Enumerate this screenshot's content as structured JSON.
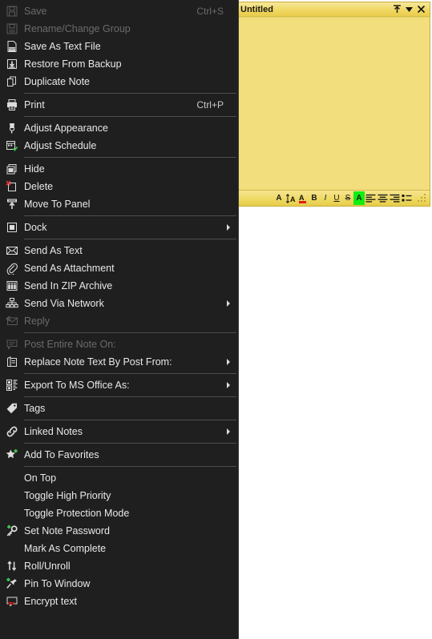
{
  "note": {
    "title": "Untitled",
    "body_text": "",
    "titlebar_buttons": [
      {
        "name": "roll-up-button",
        "glyph": "↑"
      },
      {
        "name": "note-menu-button",
        "glyph": "▼"
      },
      {
        "name": "close-button",
        "glyph": "✕"
      }
    ],
    "toolbar": [
      {
        "name": "font-button",
        "label": "A"
      },
      {
        "name": "line-spacing-button",
        "label": "A"
      },
      {
        "name": "font-color-button",
        "label": "A"
      },
      {
        "name": "bold-button",
        "label": "B"
      },
      {
        "name": "italic-button",
        "label": "I"
      },
      {
        "name": "underline-button",
        "label": "U"
      },
      {
        "name": "strikethrough-button",
        "label": "S"
      },
      {
        "name": "highlight-button",
        "label": "A"
      },
      {
        "name": "align-left-button",
        "label": ""
      },
      {
        "name": "align-center-button",
        "label": ""
      },
      {
        "name": "align-right-button",
        "label": ""
      },
      {
        "name": "bullet-list-button",
        "label": ""
      }
    ],
    "colors": {
      "note_bg": "#f3de7e",
      "titlebar": "#f0d864",
      "border": "#c9ad3a",
      "highlight": "#11ee11",
      "font_color_swatch": "#e01b1b"
    }
  },
  "menu": {
    "items": [
      {
        "id": "save",
        "label": "Save",
        "accel": "Ctrl+S",
        "icon": "save-icon",
        "disabled": true,
        "submenu": false
      },
      {
        "id": "rename",
        "label": "Rename/Change Group",
        "accel": "",
        "icon": "rename-icon",
        "disabled": true,
        "submenu": false
      },
      {
        "id": "save-as-text",
        "label": "Save As Text File",
        "accel": "",
        "icon": "save-text-file-icon",
        "disabled": false,
        "submenu": false
      },
      {
        "id": "restore-backup",
        "label": "Restore From Backup",
        "accel": "",
        "icon": "restore-backup-icon",
        "disabled": false,
        "submenu": false
      },
      {
        "id": "duplicate-note",
        "label": "Duplicate Note",
        "accel": "",
        "icon": "duplicate-icon",
        "disabled": false,
        "submenu": false
      },
      {
        "id": "sep1",
        "separator": true
      },
      {
        "id": "print",
        "label": "Print",
        "accel": "Ctrl+P",
        "icon": "printer-icon",
        "disabled": false,
        "submenu": false
      },
      {
        "id": "sep2",
        "separator": true
      },
      {
        "id": "adjust-appearance",
        "label": "Adjust Appearance",
        "accel": "",
        "icon": "paintbrush-icon",
        "disabled": false,
        "submenu": false
      },
      {
        "id": "adjust-schedule",
        "label": "Adjust Schedule",
        "accel": "",
        "icon": "calendar-icon",
        "disabled": false,
        "submenu": false
      },
      {
        "id": "sep3",
        "separator": true
      },
      {
        "id": "hide",
        "label": "Hide",
        "accel": "",
        "icon": "hide-windows-icon",
        "disabled": false,
        "submenu": false
      },
      {
        "id": "delete",
        "label": "Delete",
        "accel": "",
        "icon": "delete-icon",
        "disabled": false,
        "submenu": false
      },
      {
        "id": "move-to-panel",
        "label": "Move To Panel",
        "accel": "",
        "icon": "move-to-panel-icon",
        "disabled": false,
        "submenu": false
      },
      {
        "id": "sep4",
        "separator": true
      },
      {
        "id": "dock",
        "label": "Dock",
        "accel": "",
        "icon": "dock-icon",
        "disabled": false,
        "submenu": true
      },
      {
        "id": "sep5",
        "separator": true
      },
      {
        "id": "send-as-text",
        "label": "Send As Text",
        "accel": "",
        "icon": "envelope-icon",
        "disabled": false,
        "submenu": false
      },
      {
        "id": "send-as-attach",
        "label": "Send As Attachment",
        "accel": "",
        "icon": "paperclip-icon",
        "disabled": false,
        "submenu": false
      },
      {
        "id": "send-zip",
        "label": "Send In ZIP Archive",
        "accel": "",
        "icon": "zip-archive-icon",
        "disabled": false,
        "submenu": false
      },
      {
        "id": "send-network",
        "label": "Send Via Network",
        "accel": "",
        "icon": "network-icon",
        "disabled": false,
        "submenu": true
      },
      {
        "id": "reply",
        "label": "Reply",
        "accel": "",
        "icon": "reply-icon",
        "disabled": true,
        "submenu": false
      },
      {
        "id": "sep6",
        "separator": true
      },
      {
        "id": "post-entire",
        "label": "Post Entire Note On:",
        "accel": "",
        "icon": "comment-icon",
        "disabled": true,
        "submenu": false
      },
      {
        "id": "replace-note",
        "label": "Replace Note Text By Post From:",
        "accel": "",
        "icon": "inbox-icon",
        "disabled": false,
        "submenu": true
      },
      {
        "id": "sep7",
        "separator": true
      },
      {
        "id": "export-office",
        "label": "Export To MS Office As:",
        "accel": "",
        "icon": "ms-office-icon",
        "disabled": false,
        "submenu": true
      },
      {
        "id": "sep8",
        "separator": true
      },
      {
        "id": "tags",
        "label": "Tags",
        "accel": "",
        "icon": "tag-icon",
        "disabled": false,
        "submenu": false
      },
      {
        "id": "sep9",
        "separator": true
      },
      {
        "id": "linked-notes",
        "label": "Linked Notes",
        "accel": "",
        "icon": "link-icon",
        "disabled": false,
        "submenu": true
      },
      {
        "id": "sep10",
        "separator": true
      },
      {
        "id": "add-favorites",
        "label": "Add To Favorites",
        "accel": "",
        "icon": "star-plus-icon",
        "disabled": false,
        "submenu": false
      },
      {
        "id": "sep11",
        "separator": true
      },
      {
        "id": "on-top",
        "label": "On Top",
        "accel": "",
        "icon": "none",
        "disabled": false,
        "submenu": false
      },
      {
        "id": "toggle-priority",
        "label": "Toggle High Priority",
        "accel": "",
        "icon": "none",
        "disabled": false,
        "submenu": false
      },
      {
        "id": "toggle-protect",
        "label": "Toggle Protection Mode",
        "accel": "",
        "icon": "none",
        "disabled": false,
        "submenu": false
      },
      {
        "id": "set-password",
        "label": "Set Note Password",
        "accel": "",
        "icon": "key-plus-icon",
        "disabled": false,
        "submenu": false
      },
      {
        "id": "mark-complete",
        "label": "Mark As Complete",
        "accel": "",
        "icon": "none",
        "disabled": false,
        "submenu": false
      },
      {
        "id": "roll-unroll",
        "label": "Roll/Unroll",
        "accel": "",
        "icon": "roll-unroll-icon",
        "disabled": false,
        "submenu": false
      },
      {
        "id": "pin-to-window",
        "label": "Pin To Window",
        "accel": "",
        "icon": "pin-plus-icon",
        "disabled": false,
        "submenu": false
      },
      {
        "id": "encrypt-text",
        "label": "Encrypt text",
        "accel": "",
        "icon": "encrypt-icon",
        "disabled": false,
        "submenu": false
      }
    ],
    "colors": {
      "background": "#1f1f1f",
      "text": "#e8e8e8",
      "text_disabled": "#6b6b6b",
      "separator": "#4d4d4d"
    }
  }
}
